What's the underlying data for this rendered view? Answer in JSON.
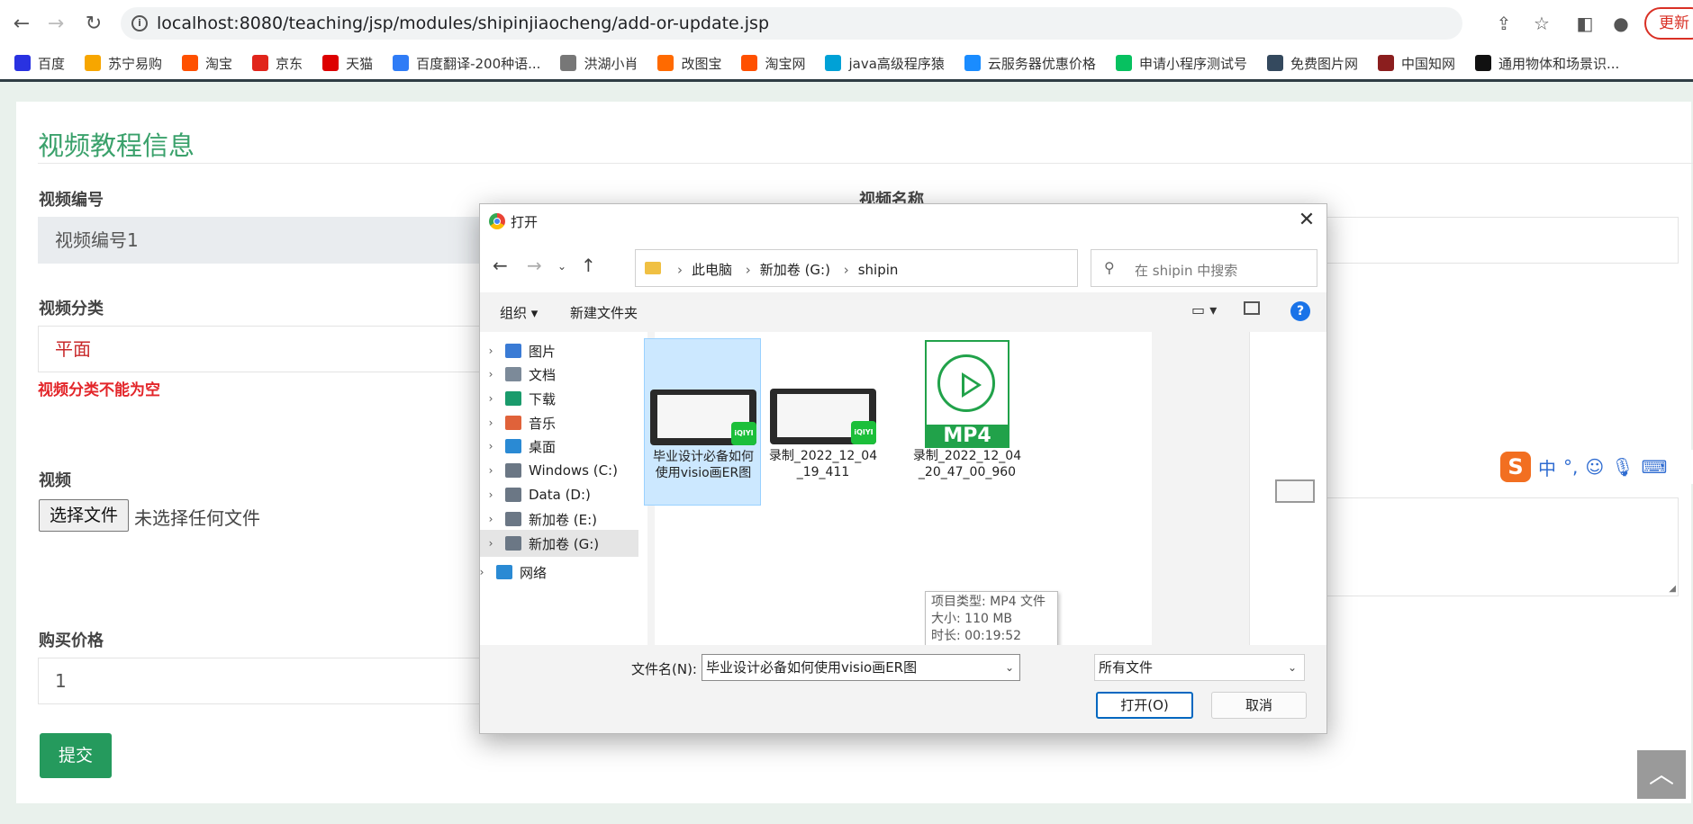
{
  "browser": {
    "url": "localhost:8080/teaching/jsp/modules/shipinjiaocheng/add-or-update.jsp",
    "update_label": "更新"
  },
  "bookmarks": [
    {
      "label": "百度",
      "color": "#2932e1"
    },
    {
      "label": "苏宁易购",
      "color": "#f7a600"
    },
    {
      "label": "淘宝",
      "color": "#ff5000"
    },
    {
      "label": "京东",
      "color": "#e1251b"
    },
    {
      "label": "天猫",
      "color": "#d00"
    },
    {
      "label": "百度翻译-200种语...",
      "color": "#2f7cf6"
    },
    {
      "label": "洪湖小肖",
      "color": "#777"
    },
    {
      "label": "改图宝",
      "color": "#ff6a00"
    },
    {
      "label": "淘宝网",
      "color": "#ff5000"
    },
    {
      "label": "java高级程序猿",
      "color": "#00a1d6"
    },
    {
      "label": "云服务器优惠价格",
      "color": "#1a8cff"
    },
    {
      "label": "申请小程序测试号",
      "color": "#07c160"
    },
    {
      "label": "免费图片网",
      "color": "#34495e"
    },
    {
      "label": "中国知网",
      "color": "#8b1e1e"
    },
    {
      "label": "通用物体和场景识...",
      "color": "#111"
    }
  ],
  "form": {
    "title": "视频教程信息",
    "video_id_label": "视频编号",
    "video_id_value": "视频编号1",
    "video_name_label": "视频名称",
    "category_label": "视频分类",
    "category_value": "平面",
    "category_error": "视频分类不能为空",
    "video_label": "视频",
    "choose_file_label": "选择文件",
    "no_file_text": "未选择任何文件",
    "price_label": "购买价格",
    "price_value": "1",
    "submit_label": "提交"
  },
  "ime": {
    "logo": "S",
    "mode": "中"
  },
  "dialog": {
    "title": "打开",
    "path": [
      "此电脑",
      "新加卷 (G:)",
      "shipin"
    ],
    "search_placeholder": "在 shipin 中搜索",
    "organize_label": "组织 ▾",
    "new_folder_label": "新建文件夹",
    "tree": [
      {
        "label": "图片",
        "color": "#3a7bd5"
      },
      {
        "label": "文档",
        "color": "#7c8a99"
      },
      {
        "label": "下载",
        "color": "#1a9b6c"
      },
      {
        "label": "音乐",
        "color": "#e0623a"
      },
      {
        "label": "桌面",
        "color": "#2a8ad4"
      },
      {
        "label": "Windows (C:)",
        "color": "#6b7785"
      },
      {
        "label": "Data (D:)",
        "color": "#6b7785"
      },
      {
        "label": "新加卷 (E:)",
        "color": "#6b7785"
      },
      {
        "label": "新加卷 (G:)",
        "color": "#6b7785"
      },
      {
        "label": "网络",
        "color": "#2a8ad4"
      }
    ],
    "files": [
      {
        "name": "毕业设计必备如何使用visio画ER图",
        "badge": "iQIYI"
      },
      {
        "name": "录制_2022_12_04_19_411",
        "badge": "iQIYI"
      },
      {
        "name": "录制_2022_12_04_20_47_00_960",
        "badge": "MP4"
      }
    ],
    "tooltip": {
      "type": "项目类型: MP4 文件",
      "size": "大小: 110 MB",
      "duration": "时长: 00:19:52"
    },
    "filename_label": "文件名(N):",
    "filename_value": "毕业设计必备如何使用visio画ER图",
    "filetype_value": "所有文件",
    "open_label": "打开(O)",
    "cancel_label": "取消"
  }
}
